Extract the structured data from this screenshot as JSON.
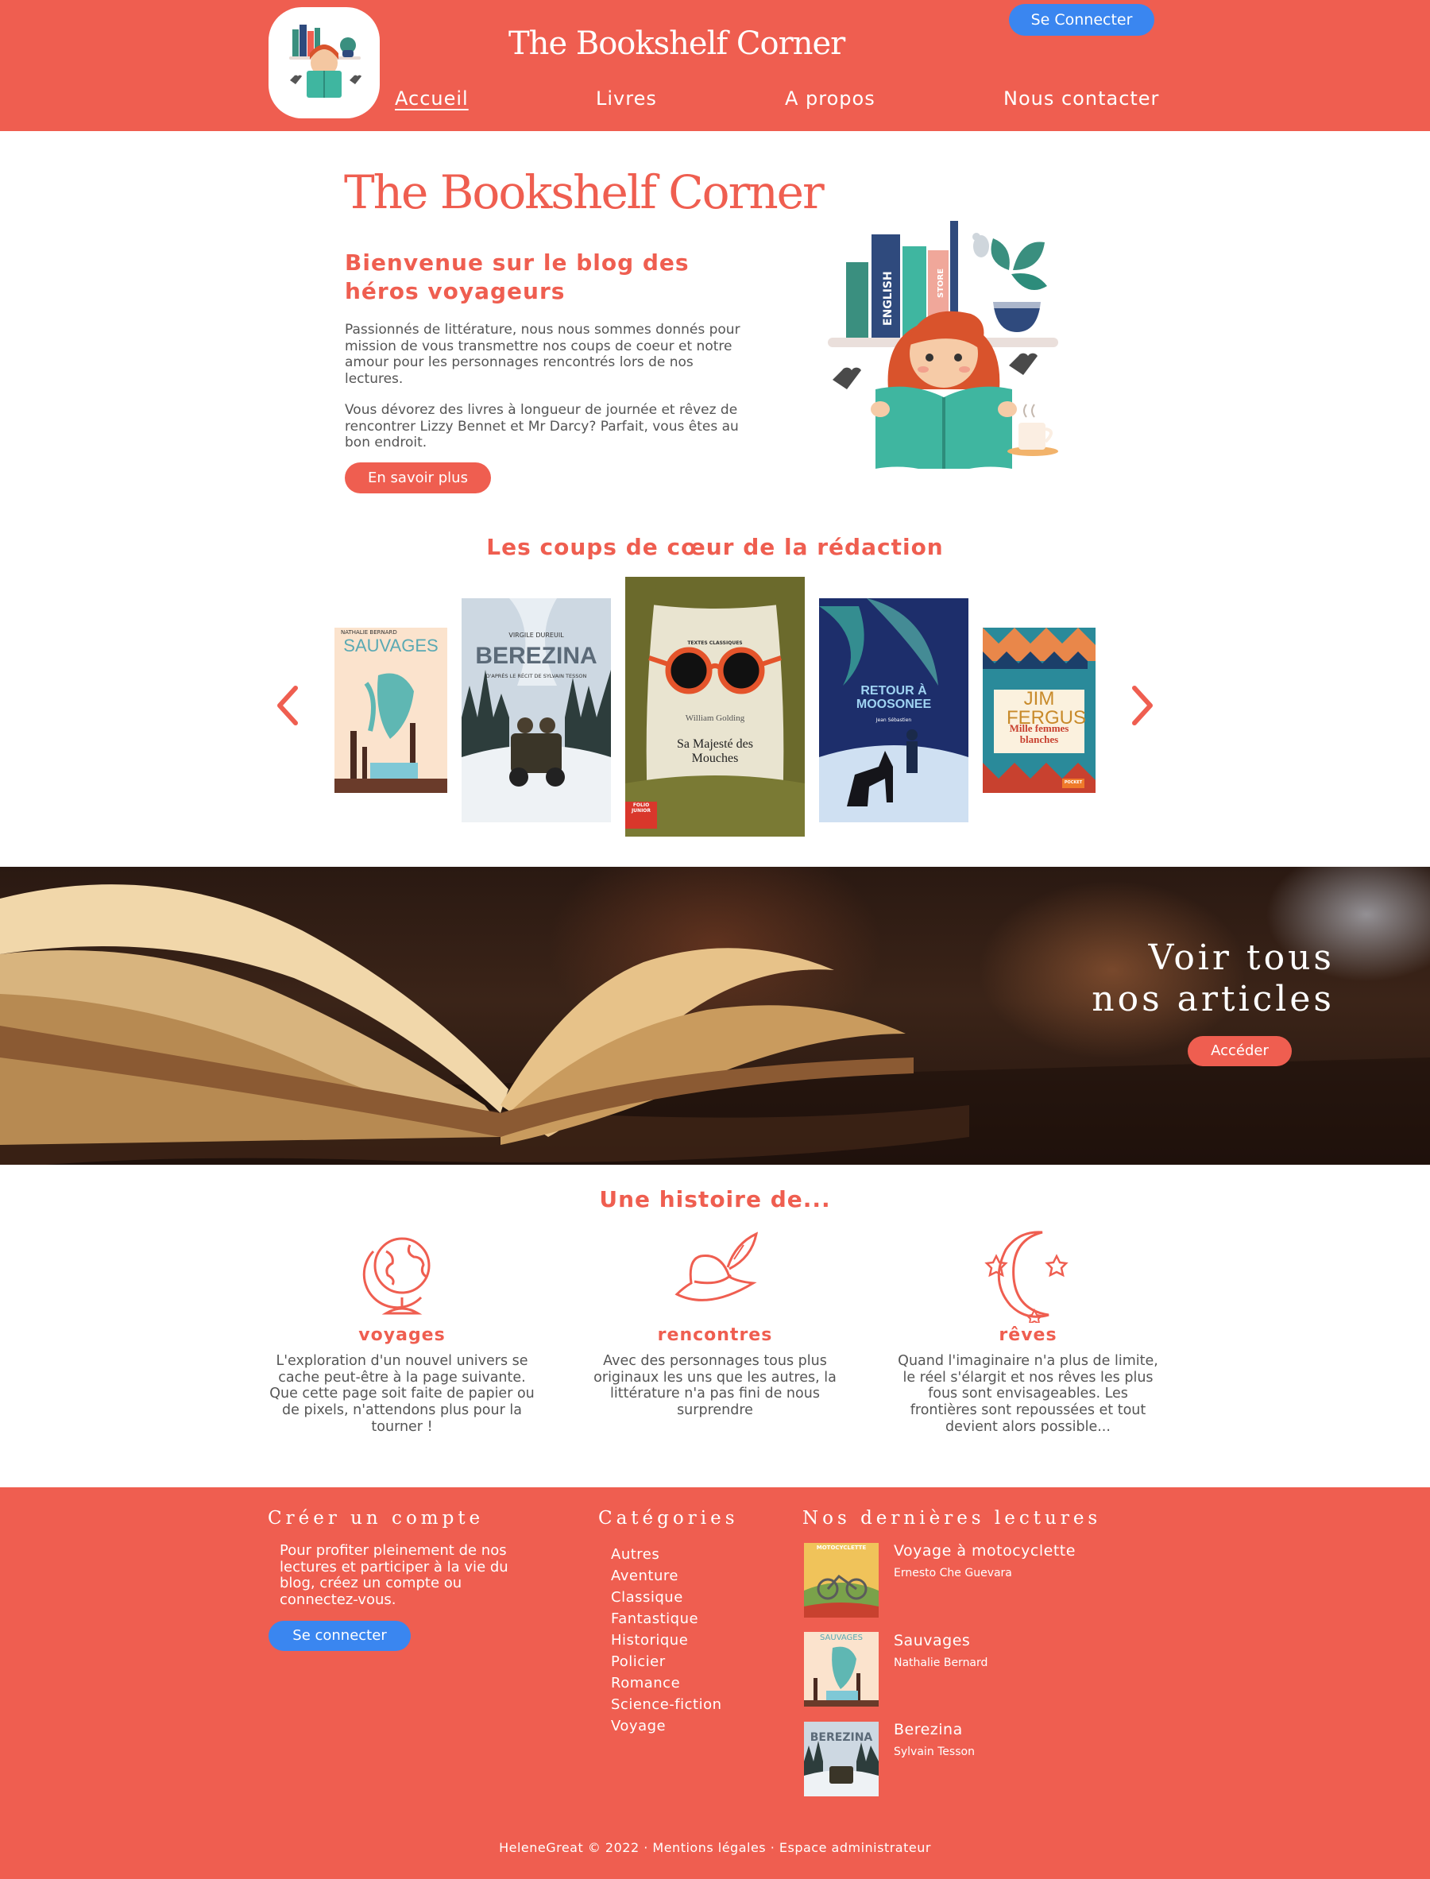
{
  "header": {
    "site_title": "The Bookshelf Corner",
    "login_label": "Se Connecter",
    "nav": [
      {
        "label": "Accueil",
        "active": true
      },
      {
        "label": "Livres",
        "active": false
      },
      {
        "label": "A propos",
        "active": false
      },
      {
        "label": "Nous contacter",
        "active": false
      }
    ]
  },
  "hero": {
    "title": "The Bookshelf Corner",
    "subtitle": "Bienvenue sur le blog des héros voyageurs",
    "paragraph1": "Passionnés de littérature, nous nous sommes donnés pour mission de vous transmettre nos coups de coeur et notre amour pour les personnages rencontrés lors de nos lectures.",
    "paragraph2": "Vous dévorez des livres à longueur de journée et rêvez de rencontrer Lizzy Bennet et Mr Darcy? Parfait, vous êtes au bon endroit.",
    "button_label": "En savoir plus",
    "illustration_spines": [
      "ENGLISH",
      "STORE"
    ]
  },
  "favorites": {
    "heading": "Les coups de cœur de la rédaction",
    "prev_icon": "chevron-left-icon",
    "next_icon": "chevron-right-icon",
    "books": [
      {
        "cover_title": "SAUVAGES",
        "cover_author": "NATHALIE BERNARD"
      },
      {
        "cover_title": "BEREZINA",
        "cover_author": "VIRGILE DUREUIL",
        "cover_subtitle": "D'APRÈS LE RÉCIT DE SYLVAIN TESSON"
      },
      {
        "cover_series": "TEXTES CLASSIQUES",
        "cover_author": "William Golding",
        "cover_title": "Sa Majesté des Mouches",
        "cover_badge": "FOLIO JUNIOR"
      },
      {
        "cover_title": "RETOUR À MOOSONEE",
        "cover_author": "Jean Sébastien"
      },
      {
        "cover_author": "JIM FERGUS",
        "cover_title": "Mille femmes blanches",
        "cover_badge": "POCKET"
      }
    ]
  },
  "banner": {
    "title_line1": "Voir tous",
    "title_line2": "nos articles",
    "button_label": "Accéder"
  },
  "stories": {
    "heading": "Une histoire de...",
    "items": [
      {
        "icon": "globe-icon",
        "title": "voyages",
        "text": "L'exploration d'un nouvel univers se cache peut-être à la page suivante. Que cette page soit faite de papier ou de pixels, n'attendons plus pour la tourner !"
      },
      {
        "icon": "hat-icon",
        "title": "rencontres",
        "text": "Avec des personnages tous plus originaux les uns que les autres, la littérature n'a pas fini de nous surprendre"
      },
      {
        "icon": "moon-stars-icon",
        "title": "rêves",
        "text": "Quand l'imaginaire n'a plus de limite, le réel s'élargit et nos rêves les plus fous sont envisageables. Les frontières sont repoussées et tout devient alors possible..."
      }
    ]
  },
  "footer": {
    "account_heading": "Créer un compte",
    "account_text": "Pour profiter pleinement de nos lectures et participer à la vie du blog, créez un compte ou connectez-vous.",
    "signup_label": "Se connecter",
    "categories_heading": "Catégories",
    "categories": [
      "Autres",
      "Aventure",
      "Classique",
      "Fantastique",
      "Historique",
      "Policier",
      "Romance",
      "Science-fiction",
      "Voyage"
    ],
    "latest_heading": "Nos dernières lectures",
    "latest": [
      {
        "title": "Voyage à motocyclette",
        "author": "Ernesto Che Guevara",
        "cover_title": "MOTOCYCLETTE"
      },
      {
        "title": "Sauvages",
        "author": "Nathalie Bernard",
        "cover_title": "SAUVAGES"
      },
      {
        "title": "Berezina",
        "author": "Sylvain Tesson",
        "cover_title": "BEREZINA"
      }
    ],
    "copyright": "HeleneGreat © 2022 · Mentions légales · Espace administrateur"
  },
  "colors": {
    "brand": "#ef5e50",
    "button_blue": "#3a86f0",
    "text": "#555555",
    "white": "#ffffff"
  }
}
